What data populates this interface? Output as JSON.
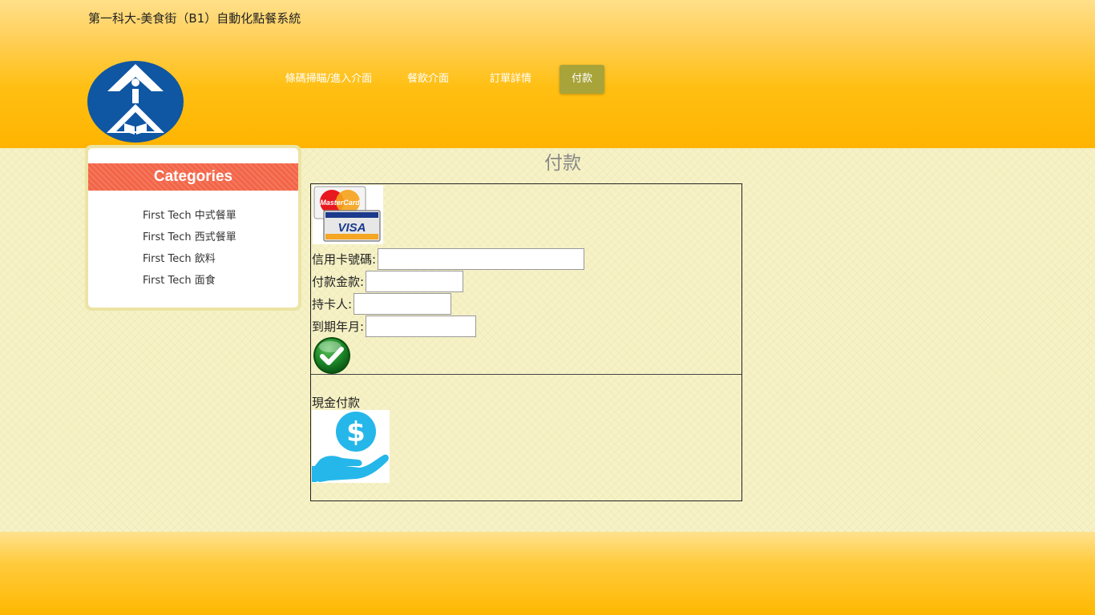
{
  "site_title": "第一科大-美食街（B1）自動化點餐系統",
  "nav": {
    "items": [
      {
        "label": "條碼掃瞄/進入介面"
      },
      {
        "label": "餐飲介面"
      },
      {
        "label": "訂單詳情"
      },
      {
        "label": "付款",
        "active": true
      }
    ]
  },
  "sidebar": {
    "heading": "Categories",
    "items": [
      {
        "label": "First Tech 中式餐單"
      },
      {
        "label": "First Tech 西式餐單"
      },
      {
        "label": "First Tech 飲料"
      },
      {
        "label": "First Tech 面食"
      }
    ]
  },
  "page": {
    "heading": "付款"
  },
  "card_form": {
    "logos": [
      "MasterCard",
      "VISA"
    ],
    "card_number_label": "信用卡號碼:",
    "amount_label": "付款金款:",
    "holder_label": "持卡人:",
    "expiry_label": "到期年月:",
    "card_number_value": "",
    "amount_value": "",
    "holder_value": "",
    "expiry_value": "",
    "submit_icon": "check-icon"
  },
  "cash": {
    "label": "現金付款",
    "icon": "cash-payment-icon"
  },
  "colors": {
    "header_accent": "#ffb400",
    "nav_active": "#a8a43a",
    "categories_header": "#f36548",
    "logo_blue": "#0f56a3",
    "cash_icon": "#25b7ea"
  }
}
